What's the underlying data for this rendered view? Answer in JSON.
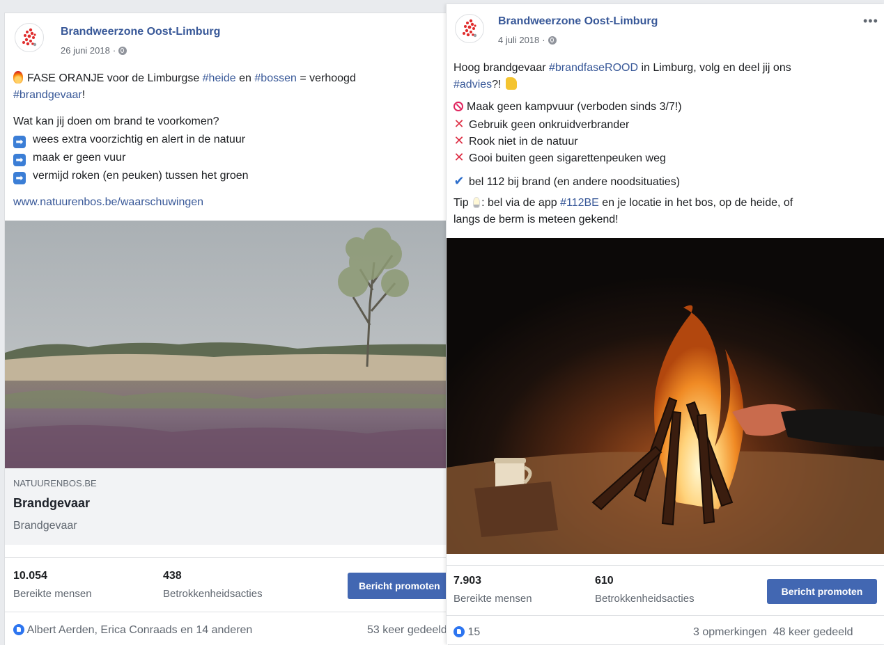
{
  "post_left": {
    "page_name": "Brandweerzone Oost-Limburg",
    "date": "26 juni 2018",
    "meta_sep": "·",
    "line1_a": "FASE ORANJE voor de Limburgse ",
    "line1_tag1": "#heide",
    "line1_b": " en ",
    "line1_tag2": "#bossen",
    "line1_c": " = verhoogd",
    "line2_tag": "#brandgevaar",
    "line2_end": "!",
    "question": "Wat kan jij doen om brand te voorkomen?",
    "tips": [
      "wees extra voorzichtig en alert in de natuur",
      "maak er geen vuur",
      "vermijd roken (en peuken) tussen het groen"
    ],
    "link": "www.natuurenbos.be/waarschuwingen",
    "link_domain": "NATUURENBOS.BE",
    "link_title": "Brandgevaar",
    "link_description": "Brandgevaar",
    "reach_value": "10.054",
    "reach_label": "Bereikte mensen",
    "engagement_value": "438",
    "engagement_label": "Betrokkenheidsacties",
    "promote_label": "Bericht promoten",
    "reactions": "Albert Aerden, Erica Conraads en 14 anderen",
    "shares": "53 keer gedeeld"
  },
  "post_right": {
    "page_name": "Brandweerzone Oost-Limburg",
    "date": "4 juli 2018",
    "meta_sep": "·",
    "more_label": "•••",
    "intro_a": "Hoog brandgevaar ",
    "intro_tag1": "#brandfaseROOD",
    "intro_b": " in Limburg, volg en deel jij ons",
    "intro_tag2": "#advies",
    "intro_end": "?!",
    "rule_no": "Maak geen kampvuur (verboden sinds 3/7!)",
    "rules_x": [
      "Gebruik geen onkruidverbrander",
      "Rook niet in de natuur",
      "Gooi buiten geen sigarettenpeuken weg"
    ],
    "call": "bel 112 bij brand (en andere noodsituaties)",
    "tip_a": "Tip",
    "tip_b": ": bel via de app ",
    "tip_tag": "#112BE",
    "tip_c": " en je locatie in het bos, op de heide, of",
    "tip_line2": "langs de berm is meteen gekend!",
    "reach_value": "7.903",
    "reach_label": "Bereikte mensen",
    "engagement_value": "610",
    "engagement_label": "Betrokkenheidsacties",
    "promote_label": "Bericht promoten",
    "like_count": "15",
    "comments_shares": "3 opmerkingen  48 keer gedeeld"
  },
  "colors": {
    "link_blue": "#385898",
    "promote_blue": "#4267b2",
    "like_blue": "#2d75f0"
  }
}
